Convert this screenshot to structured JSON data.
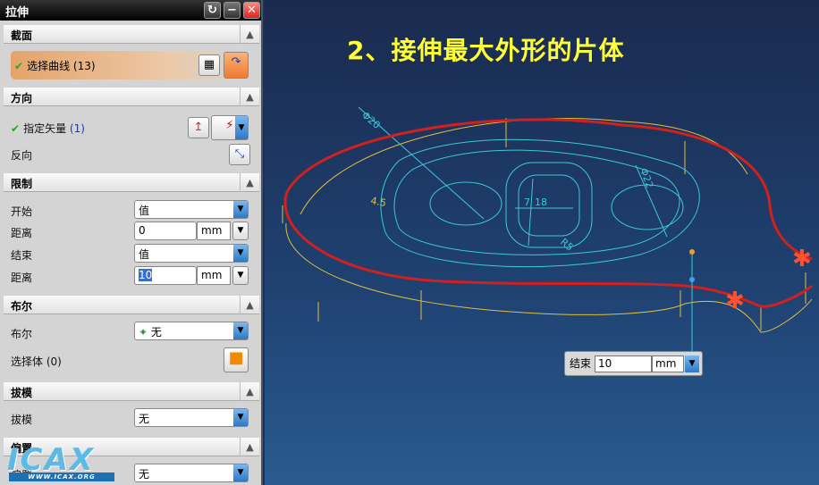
{
  "dialog": {
    "title": "拉伸"
  },
  "sections": {
    "section": {
      "title": "截面",
      "select_curve": "选择曲线",
      "count": "(13)"
    },
    "direction": {
      "title": "方向",
      "specify_vector": "指定矢量",
      "count": "(1)",
      "reverse": "反向"
    },
    "limits": {
      "title": "限制",
      "start": "开始",
      "start_value": "值",
      "distance1": "距离",
      "distance1_value": "0",
      "unit": "mm",
      "end": "结束",
      "end_value": "值",
      "distance2": "距离",
      "distance2_value": "10"
    },
    "boolean": {
      "title": "布尔",
      "label": "布尔",
      "value": "无",
      "select_body": "选择体 (0)"
    },
    "draft": {
      "title": "拔模",
      "label": "拔模",
      "value": "无"
    },
    "offset": {
      "title": "偏置",
      "label": "偏置",
      "value": "无"
    }
  },
  "viewport": {
    "title": "2、接伸最大外形的片体",
    "dims": [
      "Φ20",
      "Φ22",
      "4.5",
      "18",
      "R5",
      "7"
    ],
    "callout": {
      "label": "结束",
      "value": "10",
      "unit": "mm"
    }
  },
  "watermark": {
    "logo": "ICAX",
    "url": "WWW.ICAX.ORG"
  },
  "colors": {
    "highlight_edge": "#d02020",
    "wire": "#3cc8d8",
    "yellow": "#ffff33"
  }
}
